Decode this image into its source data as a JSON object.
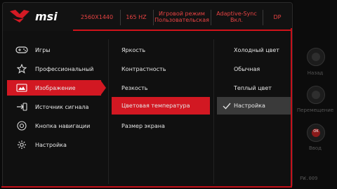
{
  "header": {
    "brand": "msi",
    "resolution": "2560X1440",
    "refresh": "165 HZ",
    "mode_line1": "Игровой режим",
    "mode_line2": "Пользовательская",
    "sync_line1": "Adaptive-Sync",
    "sync_line2": "Вкл.",
    "input": "DP"
  },
  "menu": {
    "items": [
      {
        "label": "Игры",
        "icon": "gamepad-icon"
      },
      {
        "label": "Профессиональный",
        "icon": "star-icon"
      },
      {
        "label": "Изображение",
        "icon": "image-icon"
      },
      {
        "label": "Источник сигнала",
        "icon": "input-source-icon"
      },
      {
        "label": "Кнопка навигации",
        "icon": "joystick-icon"
      },
      {
        "label": "Настройка",
        "icon": "gear-icon"
      }
    ],
    "active_index": 2
  },
  "submenu": {
    "items": [
      "Яркость",
      "Контрастность",
      "Резкость",
      "Цветовая температура",
      "Размер экрана"
    ],
    "active_index": 3
  },
  "options": {
    "items": [
      "Холодный цвет",
      "Обычная",
      "Теплый цвет",
      "Настройка"
    ],
    "selected_index": 3
  },
  "side": {
    "back": "Назад",
    "move": "Перемещение",
    "enter": "Ввод",
    "enter_key": "OK"
  },
  "firmware": "FW.009",
  "colors": {
    "accent": "#d21822",
    "background": "#101010"
  }
}
